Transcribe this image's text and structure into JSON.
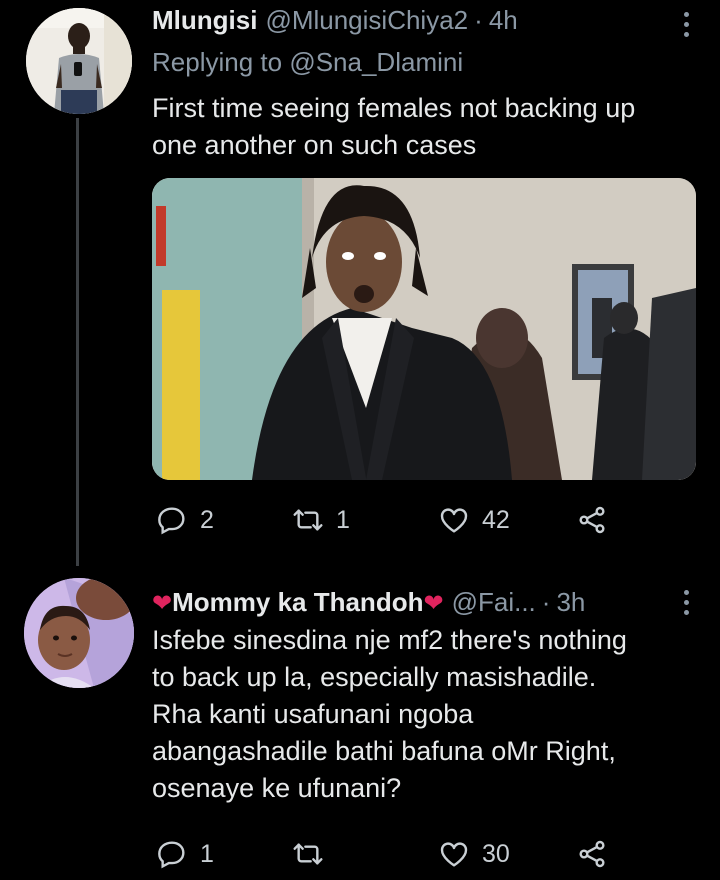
{
  "tweets": [
    {
      "name": "Mlungisi",
      "handle": "@MlungisiChiya2",
      "time": "4h",
      "replying_label": "Replying to",
      "replying_handle": "@Sna_Dlamini",
      "text": "First time seeing females not backing up\none another on such cases",
      "counts": {
        "replies": "2",
        "retweets": "1",
        "likes": "42"
      }
    },
    {
      "name_prefix_icon": "heart-emoji",
      "name": "Mommy ka Thandoh",
      "name_suffix_icon": "heart-emoji",
      "handle": "@Fai...",
      "time": "3h",
      "text": "Isfebe sinesdina nje mf2 there's nothing\nto back up la, especially masishadile.\nRha kanti usafunani ngoba\nabangashadile bathi bafuna oMr Right,\nosenaye ke ufunani?",
      "counts": {
        "replies": "1",
        "retweets": "",
        "likes": "30"
      }
    }
  ],
  "separator": "·",
  "icons": [
    "reply-icon",
    "retweet-icon",
    "like-icon",
    "share-icon",
    "more-icon"
  ],
  "colors": {
    "background": "#000000",
    "text": "#e7e9ea",
    "secondary": "#8b98a5",
    "heart": "#e0245e"
  }
}
